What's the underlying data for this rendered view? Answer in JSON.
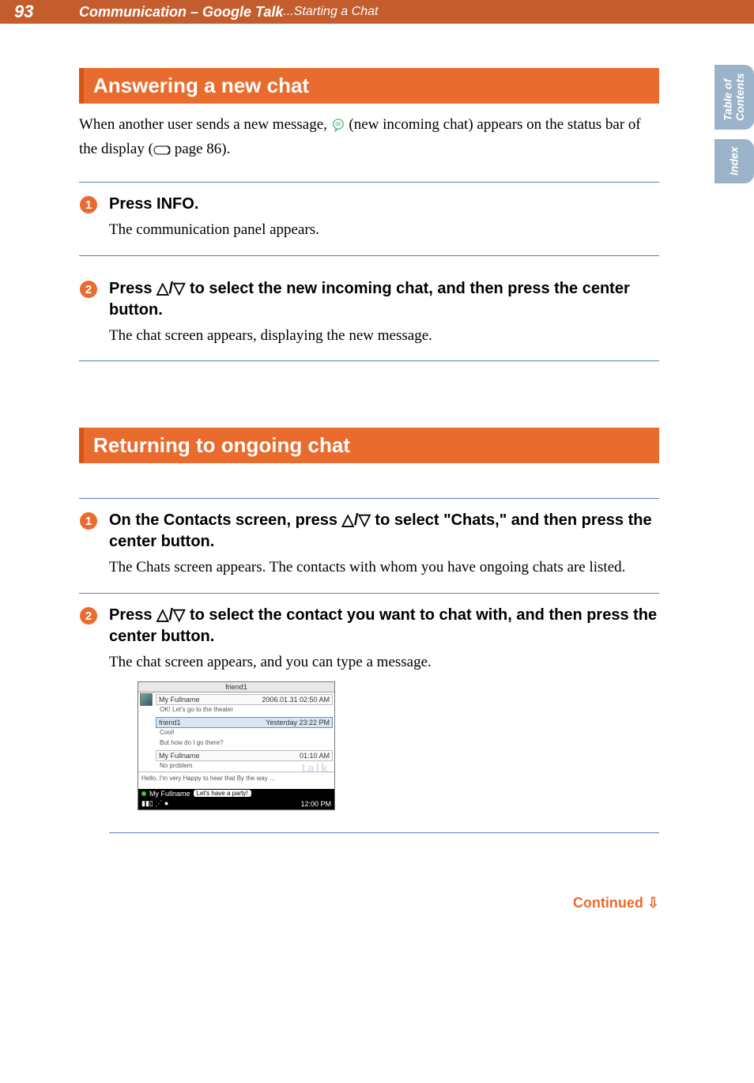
{
  "header": {
    "page_number": "93",
    "title_strong": "Communication – Google Talk",
    "title_rest": "...Starting a Chat"
  },
  "side_tabs": {
    "toc_line1": "Table of",
    "toc_line2": "Contents",
    "index": "Index"
  },
  "section1": {
    "heading": "Answering a new chat",
    "intro_before_icon": "When another user sends a new message, ",
    "intro_after_icon": " (new incoming chat) appears on the status bar of the display (",
    "intro_page_ref": " page 86).",
    "step1_title": "Press INFO.",
    "step1_desc": "The communication panel appears.",
    "step2_title_a": "Press ",
    "step2_title_b": " to select the new incoming chat, and then press the center button.",
    "step2_desc": "The chat screen appears, displaying the new message."
  },
  "section2": {
    "heading": "Returning to ongoing chat",
    "step1_title_a": "On the Contacts screen, press ",
    "step1_title_b": " to select \"Chats,\" and then press the center button.",
    "step1_desc": "The Chats screen appears. The contacts with whom you have ongoing chats are listed.",
    "step2_title_a": "Press ",
    "step2_title_b": " to select the contact you want to chat with, and then press the center button.",
    "step2_desc": "The chat screen appears, and you can type a message."
  },
  "chat": {
    "title": "friend1",
    "rows": [
      {
        "name": "My Fullname",
        "time": "2006.01.31 02:50 AM",
        "msg": "OK! Let's go to the theater"
      },
      {
        "name": "friend1",
        "time": "Yesterday 23:22 PM",
        "msg": "Cool!",
        "msg2": "But how do I go there?",
        "selected": true
      },
      {
        "name": "My Fullname",
        "time": "01:10 AM",
        "msg": "No problem"
      }
    ],
    "textarea": "Hello, I'm very Happy to hear that\nBy the way ...",
    "status_name": "My Fullname",
    "status_bubble": "Let's have a party!",
    "clock": "12:00 PM"
  },
  "continued": "Continued"
}
